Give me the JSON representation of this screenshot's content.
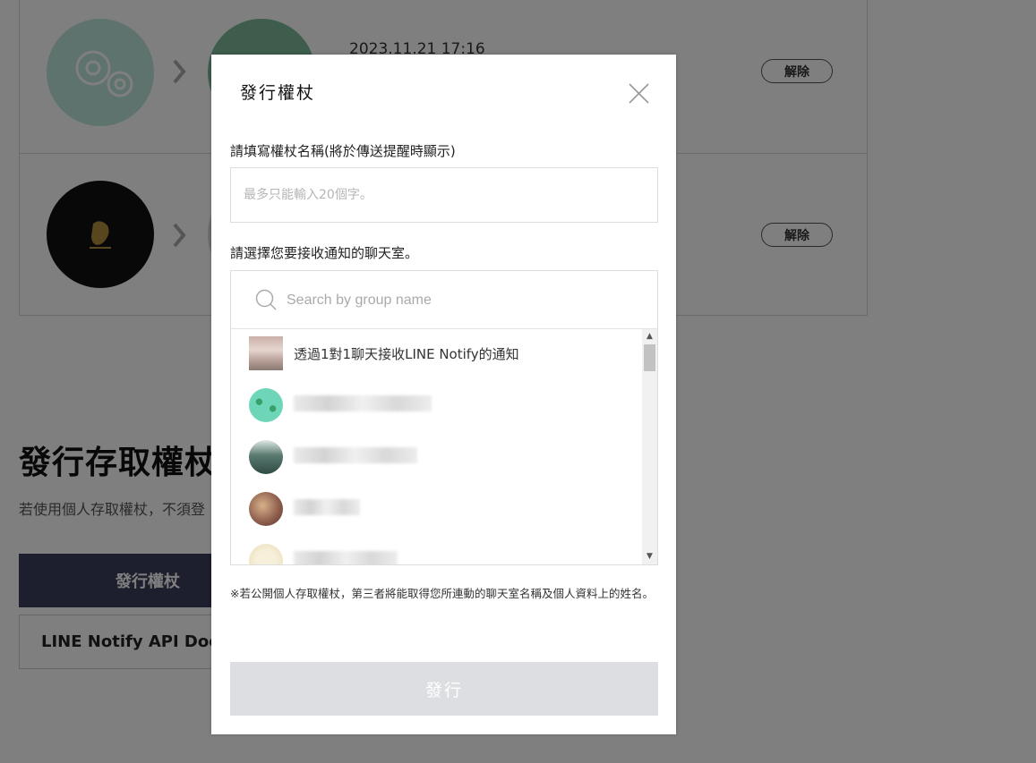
{
  "background": {
    "connections": [
      {
        "date": "2023.11.21 17:16",
        "unlink_label": "解除"
      },
      {
        "date": "",
        "unlink_label": "解除"
      }
    ],
    "section_title": "發行存取權杖",
    "section_desc": "若使用個人存取權杖，不須登",
    "issue_button": "發行權杖",
    "api_doc_button": "LINE Notify API Doc"
  },
  "modal": {
    "title": "發行權杖",
    "name_label": "請填寫權杖名稱(將於傳送提醒時顯示)",
    "name_placeholder": "最多只能輸入20個字。",
    "room_label": "請選擇您要接收通知的聊天室。",
    "search_placeholder": "Search by group name",
    "rooms": [
      {
        "name": "透過1對1聊天接收LINE Notify的通知",
        "blurred": false
      },
      {
        "name": "",
        "blurred": true
      },
      {
        "name": "",
        "blurred": true
      },
      {
        "name": "",
        "blurred": true
      },
      {
        "name": "",
        "blurred": true
      }
    ],
    "notice": "※若公開個人存取權杖，第三者將能取得您所連動的聊天室名稱及個人資料上的姓名。",
    "submit_label": "發行"
  },
  "colors": {
    "overlay": "rgba(0,0,0,0.5)",
    "primary_button": "#3a3c5c",
    "submit_disabled": "#dddee2"
  },
  "icons": [
    "gear-icon",
    "chevron-right-icon",
    "close-icon",
    "search-icon",
    "scroll-up-icon",
    "scroll-down-icon"
  ]
}
